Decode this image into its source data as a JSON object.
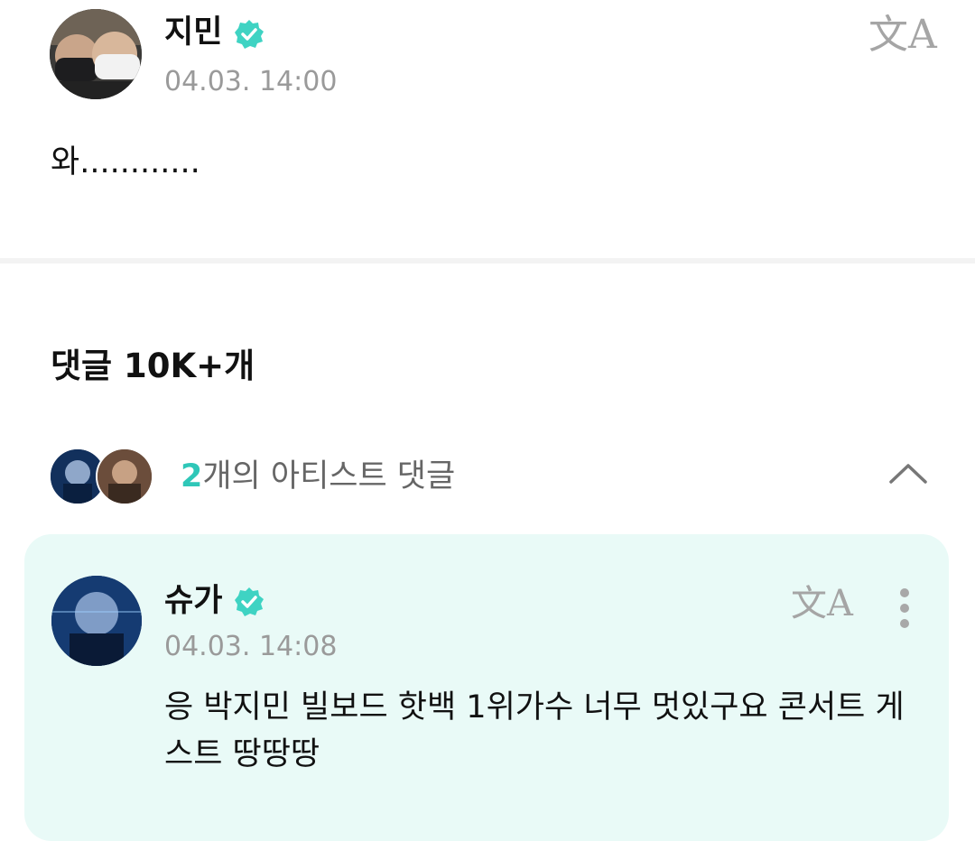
{
  "post": {
    "author": "지민",
    "timestamp": "04.03. 14:00",
    "body": "와............",
    "translate_icon": "文A"
  },
  "comments": {
    "title": "댓글 10K+개",
    "artist_summary": {
      "count": "2",
      "label_suffix": "개의 아티스트 댓글"
    },
    "items": [
      {
        "author": "슈가",
        "timestamp": "04.03. 14:08",
        "text": "응 박지민 빌보드 핫백 1위가수 너무 멋있구요 콘서트 게스트 땅땅땅",
        "translate_icon": "文A"
      }
    ]
  },
  "colors": {
    "accent_teal": "#2fc7b8",
    "verified_badge": "#3fd3c3",
    "artist_card_bg": "#e9faf7",
    "muted_text": "#9a9a9a"
  },
  "icons": [
    "verified-badge-icon",
    "translate-icon",
    "chevron-up-icon",
    "more-vertical-icon"
  ]
}
